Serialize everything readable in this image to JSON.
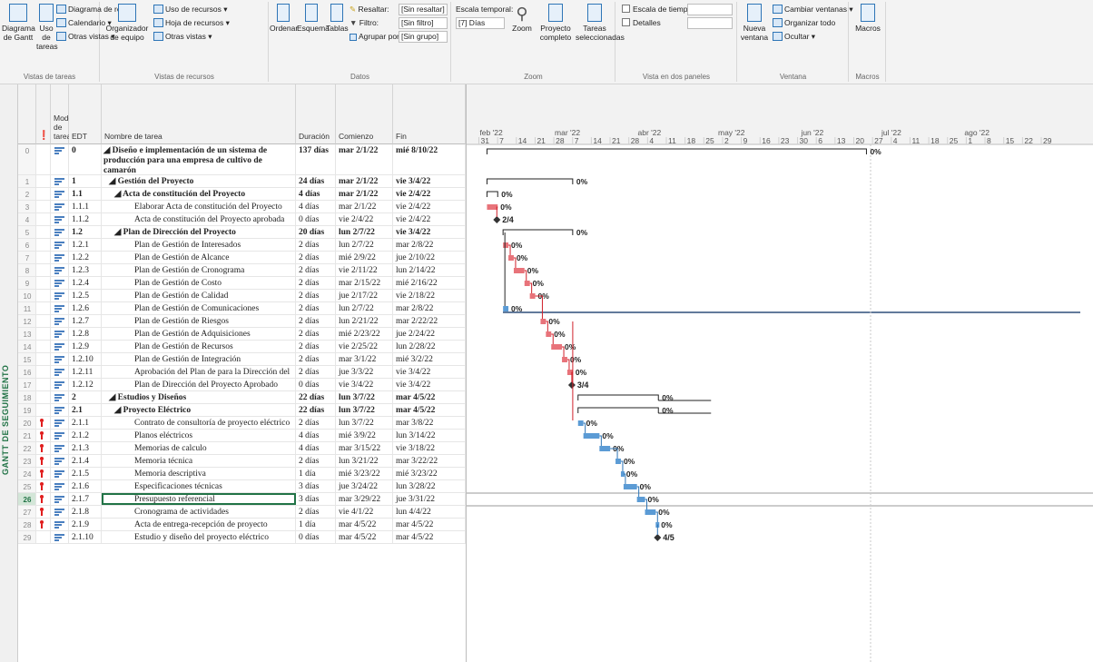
{
  "ribbon": {
    "vistas_tareas": {
      "gantt_label": "Diagrama de Gantt",
      "uso_label": "Uso de tareas",
      "red_label": "Diagrama de red",
      "calendario_label": "Calendario",
      "otras_label": "Otras vistas",
      "group_label": "Vistas de tareas"
    },
    "vistas_recursos": {
      "organizador_label": "Organizador de equipo",
      "uso_rec_label": "Uso de recursos",
      "hoja_label": "Hoja de recursos",
      "otras_label": "Otras vistas",
      "group_label": "Vistas de recursos"
    },
    "datos": {
      "ordenar_label": "Ordenar",
      "esquema_label": "Esquema",
      "tablas_label": "Tablas",
      "resaltar_label": "Resaltar:",
      "resaltar_value": "[Sin resaltar]",
      "filtro_label": "Filtro:",
      "filtro_value": "[Sin filtro]",
      "agrupar_label": "Agrupar por:",
      "agrupar_value": "[Sin grupo]",
      "group_label": "Datos"
    },
    "zoom": {
      "escala_label": "Escala temporal:",
      "escala_value": "[7] Días",
      "zoom_label": "Zoom",
      "proyecto_label": "Proyecto completo",
      "tareas_label": "Tareas seleccionadas",
      "group_label": "Zoom"
    },
    "paneles": {
      "escala_tiempo_label": "Escala de tiempo",
      "detalles_label": "Detalles",
      "group_label": "Vista en dos paneles"
    },
    "ventana": {
      "nueva_label": "Nueva ventana",
      "cambiar_label": "Cambiar ventanas",
      "organizar_label": "Organizar todo",
      "ocultar_label": "Ocultar",
      "group_label": "Ventana"
    },
    "macros": {
      "macros_label": "Macros",
      "group_label": "Macros"
    }
  },
  "sidebar_label": "GANTT DE SEGUIMIENTO",
  "columns": {
    "mode": "Modo de tarea",
    "wbs": "EDT",
    "name": "Nombre de tarea",
    "duration": "Duración",
    "start": "Comienzo",
    "finish": "Fin"
  },
  "timescale": {
    "months": [
      "feb '22",
      "mar '22",
      "abr '22",
      "may '22",
      "jun '22",
      "jul '22",
      "ago '22"
    ],
    "days": [
      "31",
      "7",
      "14",
      "21",
      "28",
      "7",
      "14",
      "21",
      "28",
      "4",
      "11",
      "18",
      "25",
      "2",
      "9",
      "16",
      "23",
      "30",
      "6",
      "13",
      "20",
      "27",
      "4",
      "11",
      "18",
      "25",
      "1",
      "8",
      "15",
      "22",
      "29"
    ]
  },
  "selected_row": 26,
  "tasks": [
    {
      "id": "0",
      "wbs": "0",
      "name": "Diseño e implementación de un sistema de producción para una empresa de cultivo de camarón",
      "dur": "137 días",
      "start": "mar 2/1/22",
      "finish": "mié 8/10/22",
      "summary": true,
      "level": 0,
      "pct": "0%"
    },
    {
      "id": "1",
      "wbs": "1",
      "name": "Gestión del Proyecto",
      "dur": "24 días",
      "start": "mar 2/1/22",
      "finish": "vie 3/4/22",
      "summary": true,
      "level": 1,
      "pct": "0%"
    },
    {
      "id": "2",
      "wbs": "1.1",
      "name": "Acta de constitución del Proyecto",
      "dur": "4 días",
      "start": "mar 2/1/22",
      "finish": "vie 2/4/22",
      "summary": true,
      "level": 2,
      "pct": "0%"
    },
    {
      "id": "3",
      "wbs": "1.1.1",
      "name": "Elaborar Acta de constitución del Proyecto",
      "dur": "4 días",
      "start": "mar 2/1/22",
      "finish": "vie 2/4/22",
      "level": 3,
      "pct": "0%"
    },
    {
      "id": "4",
      "wbs": "1.1.2",
      "name": "Acta de constitución del Proyecto aprobada",
      "dur": "0 días",
      "start": "vie 2/4/22",
      "finish": "vie 2/4/22",
      "level": 3,
      "milestone": true,
      "ms_label": "2/4"
    },
    {
      "id": "5",
      "wbs": "1.2",
      "name": "Plan de Dirección del Proyecto",
      "dur": "20 días",
      "start": "lun 2/7/22",
      "finish": "vie 3/4/22",
      "summary": true,
      "level": 2,
      "pct": "0%"
    },
    {
      "id": "6",
      "wbs": "1.2.1",
      "name": "Plan de Gestión de Interesados",
      "dur": "2 días",
      "start": "lun 2/7/22",
      "finish": "mar 2/8/22",
      "level": 3,
      "pct": "0%"
    },
    {
      "id": "7",
      "wbs": "1.2.2",
      "name": "Plan de Gestión de Alcance",
      "dur": "2 días",
      "start": "mié 2/9/22",
      "finish": "jue 2/10/22",
      "level": 3,
      "pct": "0%"
    },
    {
      "id": "8",
      "wbs": "1.2.3",
      "name": "Plan de Gestión de Cronograma",
      "dur": "2 días",
      "start": "vie 2/11/22",
      "finish": "lun 2/14/22",
      "level": 3,
      "pct": "0%"
    },
    {
      "id": "9",
      "wbs": "1.2.4",
      "name": "Plan de Gestión de Costo",
      "dur": "2 días",
      "start": "mar 2/15/22",
      "finish": "mié 2/16/22",
      "level": 3,
      "pct": "0%"
    },
    {
      "id": "10",
      "wbs": "1.2.5",
      "name": "Plan de Gestión de Calidad",
      "dur": "2 días",
      "start": "jue 2/17/22",
      "finish": "vie 2/18/22",
      "level": 3,
      "pct": "0%"
    },
    {
      "id": "11",
      "wbs": "1.2.6",
      "name": "Plan de Gestión de Comunicaciones",
      "dur": "2 días",
      "start": "lun 2/7/22",
      "finish": "mar 2/8/22",
      "level": 3,
      "pct": "0%"
    },
    {
      "id": "12",
      "wbs": "1.2.7",
      "name": "Plan de Gestión de Riesgos",
      "dur": "2 días",
      "start": "lun 2/21/22",
      "finish": "mar 2/22/22",
      "level": 3,
      "pct": "0%"
    },
    {
      "id": "13",
      "wbs": "1.2.8",
      "name": "Plan de Gestión de Adquisiciones",
      "dur": "2 días",
      "start": "mié 2/23/22",
      "finish": "jue 2/24/22",
      "level": 3,
      "pct": "0%"
    },
    {
      "id": "14",
      "wbs": "1.2.9",
      "name": "Plan de Gestión de Recursos",
      "dur": "2 días",
      "start": "vie 2/25/22",
      "finish": "lun 2/28/22",
      "level": 3,
      "pct": "0%"
    },
    {
      "id": "15",
      "wbs": "1.2.10",
      "name": "Plan de Gestión de Integración",
      "dur": "2 días",
      "start": "mar 3/1/22",
      "finish": "mié 3/2/22",
      "level": 3,
      "pct": "0%"
    },
    {
      "id": "16",
      "wbs": "1.2.11",
      "name": "Aprobación del Plan de para la Dirección del Pr",
      "dur": "2 días",
      "start": "jue 3/3/22",
      "finish": "vie 3/4/22",
      "level": 3,
      "pct": "0%"
    },
    {
      "id": "17",
      "wbs": "1.2.12",
      "name": "Plan de Dirección del Proyecto Aprobado",
      "dur": "0 días",
      "start": "vie 3/4/22",
      "finish": "vie 3/4/22",
      "level": 3,
      "milestone": true,
      "ms_label": "3/4"
    },
    {
      "id": "18",
      "wbs": "2",
      "name": "Estudios y Diseños",
      "dur": "22 días",
      "start": "lun 3/7/22",
      "finish": "mar 4/5/22",
      "summary": true,
      "level": 1,
      "pct": "0%"
    },
    {
      "id": "19",
      "wbs": "2.1",
      "name": "Proyecto Eléctrico",
      "dur": "22 días",
      "start": "lun 3/7/22",
      "finish": "mar 4/5/22",
      "summary": true,
      "level": 2,
      "pct": "0%"
    },
    {
      "id": "20",
      "wbs": "2.1.1",
      "name": "Contrato de consultoría de proyecto eléctrico",
      "dur": "2 días",
      "start": "lun 3/7/22",
      "finish": "mar 3/8/22",
      "level": 3,
      "pin": true,
      "pct": "0%"
    },
    {
      "id": "21",
      "wbs": "2.1.2",
      "name": "Planos eléctricos",
      "dur": "4 días",
      "start": "mié 3/9/22",
      "finish": "lun 3/14/22",
      "level": 3,
      "pin": true,
      "pct": "0%"
    },
    {
      "id": "22",
      "wbs": "2.1.3",
      "name": "Memorias de calculo",
      "dur": "4 días",
      "start": "mar 3/15/22",
      "finish": "vie 3/18/22",
      "level": 3,
      "pin": true,
      "pct": "0%"
    },
    {
      "id": "23",
      "wbs": "2.1.4",
      "name": "Memoria técnica",
      "dur": "2 días",
      "start": "lun 3/21/22",
      "finish": "mar 3/22/22",
      "level": 3,
      "pin": true,
      "pct": "0%"
    },
    {
      "id": "24",
      "wbs": "2.1.5",
      "name": "Memoria descriptiva",
      "dur": "1 día",
      "start": "mié 3/23/22",
      "finish": "mié 3/23/22",
      "level": 3,
      "pin": true,
      "pct": "0%"
    },
    {
      "id": "25",
      "wbs": "2.1.6",
      "name": "Especificaciones técnicas",
      "dur": "3 días",
      "start": "jue 3/24/22",
      "finish": "lun 3/28/22",
      "level": 3,
      "pin": true,
      "pct": "0%"
    },
    {
      "id": "26",
      "wbs": "2.1.7",
      "name": "Presupuesto referencial",
      "dur": "3 días",
      "start": "mar 3/29/22",
      "finish": "jue 3/31/22",
      "level": 3,
      "pin": true,
      "pct": "0%"
    },
    {
      "id": "27",
      "wbs": "2.1.8",
      "name": "Cronograma de actividades",
      "dur": "2 días",
      "start": "vie 4/1/22",
      "finish": "lun 4/4/22",
      "level": 3,
      "pin": true,
      "pct": "0%"
    },
    {
      "id": "28",
      "wbs": "2.1.9",
      "name": "Acta de entrega-recepción de proyecto eléctrico",
      "dur": "1 día",
      "start": "mar 4/5/22",
      "finish": "mar 4/5/22",
      "level": 3,
      "pin": true,
      "pct": "0%"
    },
    {
      "id": "29",
      "wbs": "2.1.10",
      "name": "Estudio y diseño del proyecto eléctrico recibido",
      "dur": "0 días",
      "start": "mar 4/5/22",
      "finish": "mar 4/5/22",
      "level": 3,
      "milestone": true,
      "ms_label": "4/5"
    }
  ],
  "colors": {
    "accent": "#217346",
    "critical": "#e8737a",
    "normal": "#5b9bd5",
    "summary": "#000000",
    "connector_critical": "#d0202a",
    "connector_normal": "#2e75b6"
  }
}
